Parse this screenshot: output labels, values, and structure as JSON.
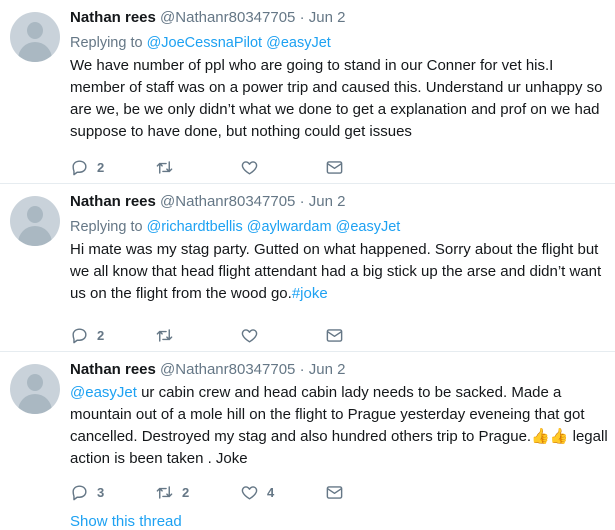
{
  "tweets": [
    {
      "name": "Nathan rees",
      "handle": "@Nathanr80347705",
      "dot": "·",
      "date": "Jun 2",
      "replying_prefix": "Replying to",
      "reply_to": [
        "@JoeCessnaPilot",
        "@easyJet"
      ],
      "text": "We have number of ppl who are going to stand in our Conner for vet his.I member of staff was on a power trip and caused this. Understand ur unhappy so are we, be we only didn’t what we done to get a explanation and prof on we had suppose to have done, but nothing could get issues",
      "reply_count": "2",
      "retweet_count": "",
      "like_count": ""
    },
    {
      "name": "Nathan rees",
      "handle": "@Nathanr80347705",
      "dot": "·",
      "date": "Jun 2",
      "replying_prefix": "Replying to",
      "reply_to": [
        "@richardtbellis",
        "@aylwardam",
        "@easyJet"
      ],
      "text_main": "Hi mate was my stag party. Gutted on what happened. Sorry about the flight but we all know that head flight attendant had a big stick up the arse and didn’t want us on the flight from the wood go.",
      "hashtag": "#joke",
      "reply_count": "2",
      "retweet_count": "",
      "like_count": ""
    },
    {
      "name": "Nathan rees",
      "handle": "@Nathanr80347705",
      "dot": "·",
      "date": "Jun 2",
      "mention": "@easyJet",
      "text_main": " ur cabin crew and head cabin lady needs to be sacked. Made a mountain out of a mole hill on the flight to Prague yesterday eveneing that got cancelled. Destroyed my stag and also hundred others trip to Prague.",
      "emoji": "👍👍",
      "text_end": " legall action is been taken . Joke",
      "reply_count": "3",
      "retweet_count": "2",
      "like_count": "4"
    }
  ],
  "show_thread": "Show this thread",
  "colors": {
    "link": "#1da1f2",
    "muted": "#657786",
    "text": "#14171a",
    "divider": "#e6ecf0"
  },
  "icons": [
    "avatar",
    "reply-icon",
    "retweet-icon",
    "like-icon",
    "dm-icon"
  ]
}
